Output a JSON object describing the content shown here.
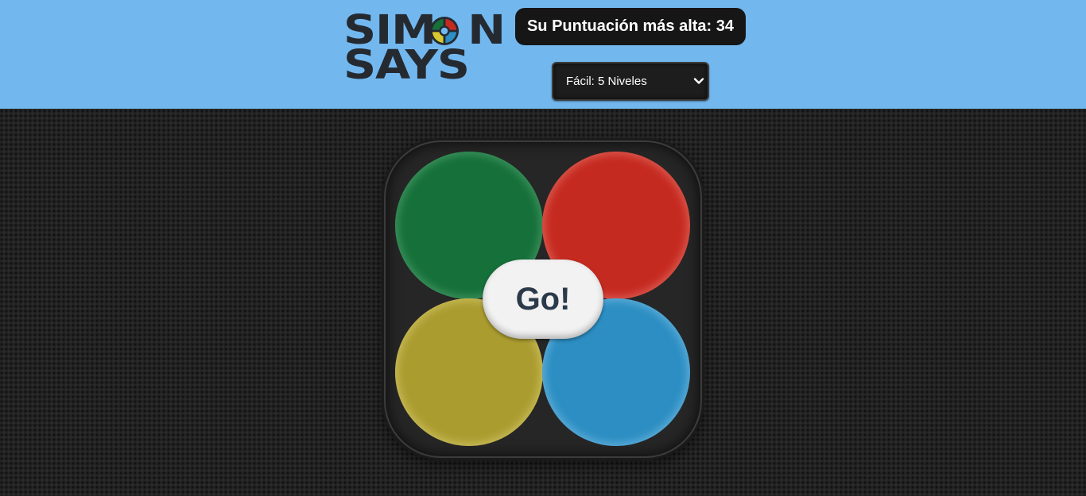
{
  "header": {
    "logo": {
      "line1_before_o": "SIM",
      "line1_after_o": "N",
      "line2": "SAYS",
      "o_icon": "simon-colors-icon",
      "icon_colors": [
        "#16703a",
        "#c52a20",
        "#aa9c2f",
        "#2c8ec2"
      ]
    },
    "high_score_label": "Su Puntuación más alta: 34",
    "level_select": {
      "selected": "Fácil: 5 Niveles",
      "icon": "chevron-down-icon"
    }
  },
  "game": {
    "pads": [
      {
        "name": "green",
        "color": "#16703a"
      },
      {
        "name": "red",
        "color": "#c52a20"
      },
      {
        "name": "yellow",
        "color": "#aa9c2f"
      },
      {
        "name": "blue",
        "color": "#2c8ec2"
      }
    ],
    "start_label": "Go!"
  },
  "colors": {
    "header_bg": "#72b8ef",
    "page_bg": "#232323",
    "logo_text": "#252a31"
  }
}
